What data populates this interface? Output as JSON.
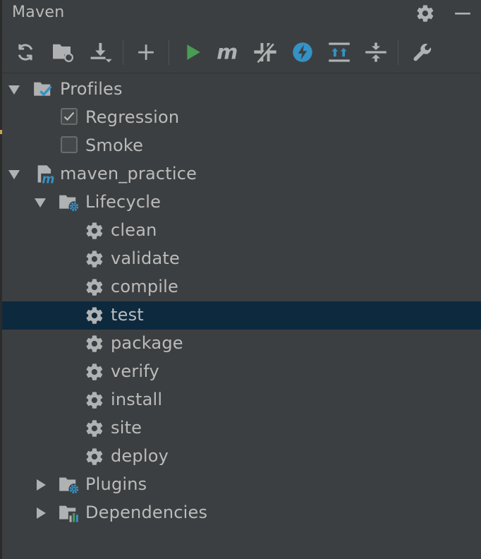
{
  "window": {
    "title": "Maven"
  },
  "title_actions": [
    {
      "name": "settings-button",
      "icon": "gear-icon"
    },
    {
      "name": "minimize-button",
      "icon": "minus-icon"
    }
  ],
  "toolbar": {
    "buttons": [
      {
        "name": "reload-button",
        "icon": "refresh-icon"
      },
      {
        "name": "generate-sources-button",
        "icon": "folder-refresh-icon"
      },
      {
        "name": "download-button",
        "icon": "download-icon"
      },
      {
        "name": "add-project-button",
        "icon": "plus-icon"
      },
      {
        "name": "run-button",
        "icon": "play-icon",
        "color": "#499c54"
      },
      {
        "name": "execute-goal-button",
        "icon": "maven-m-icon"
      },
      {
        "name": "toggle-offline-button",
        "icon": "offline-icon"
      },
      {
        "name": "skip-tests-button",
        "icon": "lightning-icon",
        "color": "#3592c4"
      },
      {
        "name": "show-dependencies-button",
        "icon": "expand-all-icon"
      },
      {
        "name": "collapse-all-button",
        "icon": "collapse-all-icon"
      },
      {
        "name": "maven-settings-button",
        "icon": "wrench-icon"
      }
    ]
  },
  "tree": {
    "profiles": {
      "label": "Profiles",
      "expanded": true,
      "items": [
        {
          "label": "Regression",
          "checked": true
        },
        {
          "label": "Smoke",
          "checked": false
        }
      ]
    },
    "project": {
      "label": "maven_practice",
      "expanded": true,
      "lifecycle": {
        "label": "Lifecycle",
        "expanded": true,
        "goals": [
          "clean",
          "validate",
          "compile",
          "test",
          "package",
          "verify",
          "install",
          "site",
          "deploy"
        ],
        "selected": "test"
      },
      "plugins": {
        "label": "Plugins",
        "expanded": false
      },
      "dependencies": {
        "label": "Dependencies",
        "expanded": false
      }
    }
  },
  "colors": {
    "background": "#3c3f41",
    "text": "#bbbbbb",
    "selection": "#0d293e",
    "accent_blue": "#3592c4",
    "accent_green": "#499c54"
  }
}
